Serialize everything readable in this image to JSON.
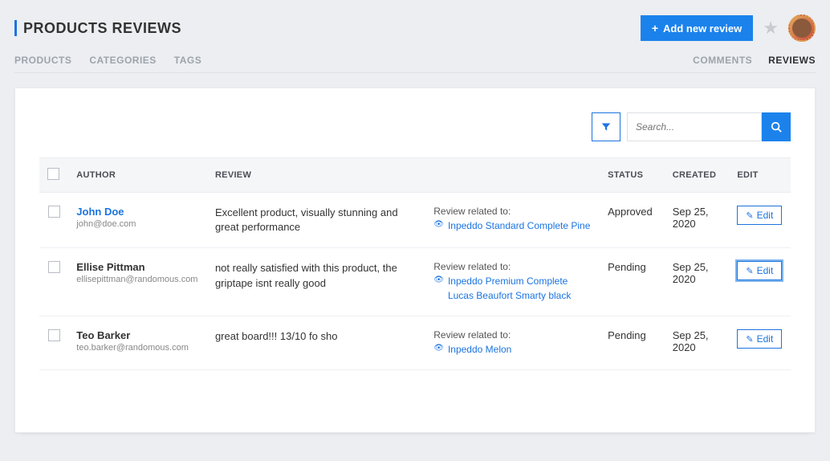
{
  "header": {
    "title": "PRODUCTS REVIEWS",
    "add_button": "Add new review"
  },
  "nav": {
    "left": [
      "PRODUCTS",
      "CATEGORIES",
      "TAGS"
    ],
    "right": [
      "COMMENTS",
      "REVIEWS"
    ],
    "right_active_index": 1
  },
  "toolbar": {
    "search_placeholder": "Search..."
  },
  "table": {
    "headers": {
      "author": "AUTHOR",
      "review": "REVIEW",
      "status": "STATUS",
      "created": "CREATED",
      "edit": "EDIT"
    },
    "related_label": "Review related to:",
    "edit_label": "Edit",
    "rows": [
      {
        "author_name": "John Doe",
        "author_link": true,
        "author_email": "john@doe.com",
        "review": "Excellent product, visually stunning and great performance",
        "related": "Inpeddo Standard Complete Pine",
        "status": "Approved",
        "created": "Sep 25, 2020",
        "highlight": false
      },
      {
        "author_name": "Ellise Pittman",
        "author_link": false,
        "author_email": "ellisepittman@randomous.com",
        "review": "not really satisfied with this product, the griptape isnt really good",
        "related": "Inpeddo Premium Complete Lucas Beaufort Smarty black",
        "status": "Pending",
        "created": "Sep 25, 2020",
        "highlight": true
      },
      {
        "author_name": "Teo Barker",
        "author_link": false,
        "author_email": "teo.barker@randomous.com",
        "review": "great board!!! 13/10 fo sho",
        "related": "Inpeddo Melon",
        "status": "Pending",
        "created": "Sep 25, 2020",
        "highlight": false
      }
    ]
  }
}
